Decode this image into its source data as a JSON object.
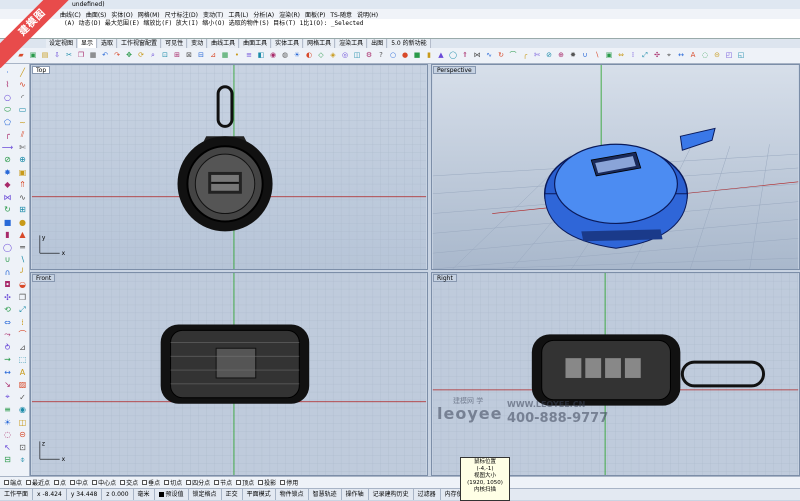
{
  "app": {
    "title": "undefined)"
  },
  "menu": [
    "曲线(C)",
    "曲面(S)",
    "实体(O)",
    "网格(M)",
    "尺寸标注(D)",
    "变动(T)",
    "工具(L)",
    "分析(A)",
    "渲染(R)",
    "面板(P)",
    "TS-随意",
    "说明(H)"
  ],
  "command_history": {
    "line1": "(A)   动态(D)   最大范围(E)   缩放比(F)   放大(I)   缩小(O)   选取的物件(S)   目标(T)   1比1(O): _Selected",
    "line2": ""
  },
  "tabs": [
    {
      "label": "设定视图"
    },
    {
      "label": "显示"
    },
    {
      "label": "选取"
    },
    {
      "label": "工作视窗配置"
    },
    {
      "label": "可见性"
    },
    {
      "label": "变动"
    },
    {
      "label": "曲线工具"
    },
    {
      "label": "曲面工具"
    },
    {
      "label": "实体工具"
    },
    {
      "label": "网格工具"
    },
    {
      "label": "渲染工具"
    },
    {
      "label": "出图"
    },
    {
      "label": "5.0 的新功能"
    }
  ],
  "active_tab": 1,
  "viewports": {
    "top": {
      "label": "Top"
    },
    "perspective": {
      "label": "Perspective"
    },
    "front": {
      "label": "Front"
    },
    "right": {
      "label": "Right"
    }
  },
  "axis_labels": {
    "x": "x",
    "y": "y",
    "z": "z"
  },
  "osnaps": [
    {
      "label": "端点",
      "checked": false
    },
    {
      "label": "最近点",
      "checked": false
    },
    {
      "label": "点",
      "checked": false
    },
    {
      "label": "中点",
      "checked": false
    },
    {
      "label": "中心点",
      "checked": false
    },
    {
      "label": "交点",
      "checked": false
    },
    {
      "label": "垂点",
      "checked": false
    },
    {
      "label": "切点",
      "checked": false
    },
    {
      "label": "四分点",
      "checked": false
    },
    {
      "label": "节点",
      "checked": false
    },
    {
      "label": "顶点",
      "checked": false
    },
    {
      "label": "投影",
      "checked": false
    },
    {
      "label": "停用",
      "checked": false
    }
  ],
  "status": {
    "cplane": "工作平面",
    "x": "x -8.424",
    "y": "y 34.448",
    "z": "z 0.000",
    "units": "毫米",
    "layer": "预设值",
    "grid_snap": "锁定格点",
    "ortho": "正交",
    "planar": "平面模式",
    "osnap": "物件锁点",
    "smarttrack": "智慧轨迹",
    "gumball": "操作轴",
    "record_history": "记录建构历史",
    "filter": "过滤器",
    "memory": "内存使用量: 440 MB"
  },
  "tooltip": {
    "line1": "鼠标位置",
    "line2": "(-4,-1)",
    "line3": "视图大小",
    "line4": "(1920, 1050)",
    "line5": "内核扫描"
  },
  "watermark": {
    "chinese": "建模网 学",
    "logo": "leoyee",
    "url": "WWW.LEOYEE.CN",
    "phone": "400-888-9777"
  },
  "ribbon": "建模图",
  "colors": {
    "grid_bg": "#bcc8d8",
    "grid_line": "#a7b5c8",
    "model_blue": "#3a78e8",
    "x_axis": "#b02020",
    "y_axis": "#20a020"
  }
}
